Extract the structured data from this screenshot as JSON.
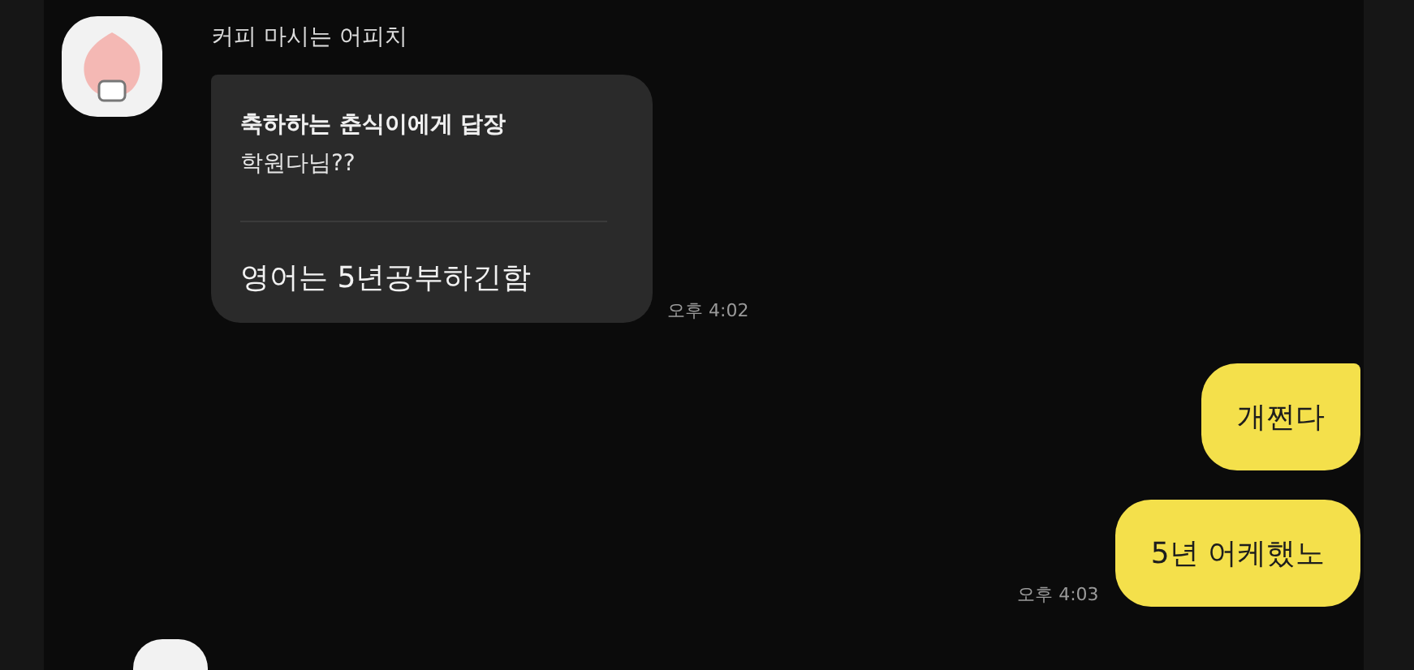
{
  "messages": [
    {
      "kind": "incoming",
      "sender": "커피 마시는 어피치",
      "reply_to": "축하하는 춘식이에게 답장",
      "quoted": "학원다님??",
      "text": "영어는 5년공부하긴함",
      "time": "오후 4:02"
    },
    {
      "kind": "outgoing",
      "texts": [
        "개쩐다",
        "5년 어케했노"
      ],
      "time": "오후 4:03"
    },
    {
      "kind": "incoming_cut"
    }
  ]
}
